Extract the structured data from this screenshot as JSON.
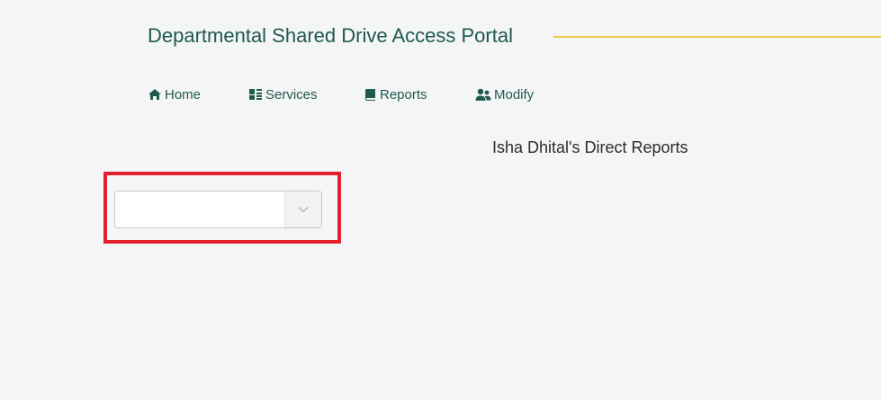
{
  "header": {
    "title": "Departmental Shared Drive Access Portal"
  },
  "nav": {
    "items": [
      {
        "label": "Home",
        "icon": "home-icon"
      },
      {
        "label": "Services",
        "icon": "list-icon"
      },
      {
        "label": "Reports",
        "icon": "book-icon"
      },
      {
        "label": "Modify",
        "icon": "users-icon"
      }
    ]
  },
  "main": {
    "heading": "Isha Dhital's Direct Reports",
    "select": {
      "value": ""
    }
  },
  "colors": {
    "brand": "#1f5a4a",
    "accent_line": "#f1c84b",
    "highlight": "#e3212b",
    "background": "#f4f5f7"
  }
}
